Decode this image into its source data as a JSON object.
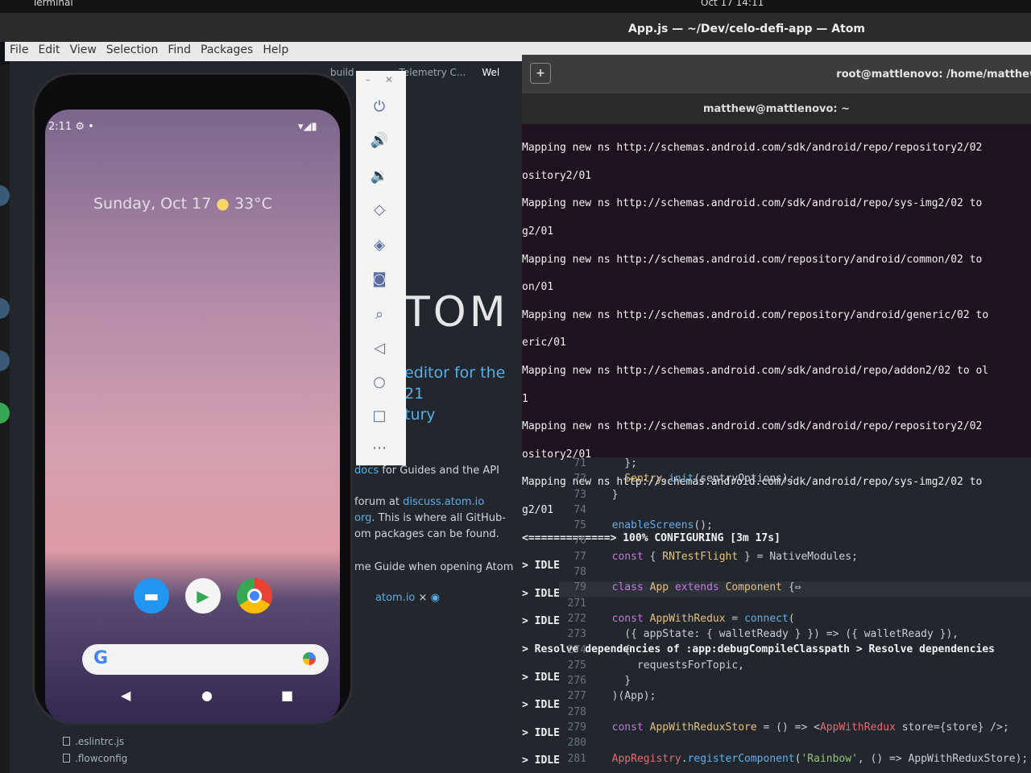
{
  "topbar": {
    "app": "Terminal",
    "clock": "Oct 17  14:11"
  },
  "atom": {
    "title": "App.js — ~/Dev/celo-defi-app — Atom",
    "menu": [
      "File",
      "Edit",
      "View",
      "Selection",
      "Find",
      "Packages",
      "Help"
    ],
    "tabs": [
      "build",
      "Telemetry C...",
      "Wel"
    ],
    "tree_bottom": [
      ".eslintrc.js",
      ".flowconfig"
    ]
  },
  "welcome": {
    "logo": "TOM",
    "title_line1": "editor for the 21",
    "title_line2": "tury",
    "docs_link": "docs",
    "docs_text": " for Guides and the API",
    "forum_text": "forum at ",
    "forum_link": "discuss.atom.io",
    "org_link": "org",
    "org_text": ". This is where all GitHub-",
    "packages_text": "om packages can be found.",
    "guide_text": "me Guide when opening Atom",
    "footer_link": "atom.io",
    "footer_sep": "×"
  },
  "phone": {
    "time": "2:11",
    "date": "Sunday, Oct 17",
    "weather": "33°C",
    "nav_back": "◀",
    "nav_home": "●",
    "nav_recents": "■"
  },
  "terminal": {
    "window_title": "root@mattlenovo: /home/matthew",
    "tab_title": "matthew@mattlenovo: ~",
    "lines": [
      "Mapping new ns http://schemas.android.com/sdk/android/repo/repository2/02",
      "ository2/01",
      "Mapping new ns http://schemas.android.com/sdk/android/repo/sys-img2/02 to",
      "g2/01",
      "Mapping new ns http://schemas.android.com/repository/android/common/02 to",
      "on/01",
      "Mapping new ns http://schemas.android.com/repository/android/generic/02 to",
      "eric/01",
      "Mapping new ns http://schemas.android.com/sdk/android/repo/addon2/02 to ol",
      "1",
      "Mapping new ns http://schemas.android.com/sdk/android/repo/repository2/02",
      "ository2/01",
      "Mapping new ns http://schemas.android.com/sdk/android/repo/sys-img2/02 to",
      "g2/01"
    ],
    "progress": "<=============> 100% CONFIGURING [3m 17s]",
    "idle_1": "> IDLE",
    "idle_2": "> IDLE",
    "idle_3": "> IDLE",
    "resolve": "> Resolve dependencies of :app:debugCompileClasspath > Resolve dependencies",
    "idle_4": "> IDLE",
    "idle_5": "> IDLE",
    "idle_6": "> IDLE",
    "idle_7": "> IDLE"
  },
  "code": {
    "l71": {
      "n": "71",
      "t": "    };"
    },
    "l72": {
      "n": "72",
      "a": "    ",
      "b": "Sentry",
      "c": ".",
      "d": "init",
      "e": "(sentryOptions);"
    },
    "l73": {
      "n": "73",
      "t": "  }"
    },
    "l74": {
      "n": "74",
      "t": ""
    },
    "l75": {
      "n": "75",
      "a": "  ",
      "b": "enableScreens",
      "c": "();"
    },
    "l76": {
      "n": "76",
      "t": ""
    },
    "l77": {
      "n": "77",
      "a": "  ",
      "b": "const",
      "c": " { ",
      "d": "RNTestFlight",
      "e": " } = NativeModules;"
    },
    "l78": {
      "n": "78",
      "t": ""
    },
    "l79": {
      "n": "79",
      "a": "  ",
      "b": "class",
      "c": " ",
      "d": "App",
      "e": " ",
      "f": "extends",
      "g": " ",
      "h": "Component",
      "i": " {⇔"
    },
    "l271": {
      "n": "271",
      "t": ""
    },
    "l272": {
      "n": "272",
      "a": "  ",
      "b": "const",
      "c": " ",
      "d": "AppWithRedux",
      "e": " = ",
      "f": "connect",
      "g": "("
    },
    "l273": {
      "n": "273",
      "t": "    ({ appState: { walletReady } }) => ({ walletReady }),"
    },
    "l274": {
      "n": "274",
      "t": "    {"
    },
    "l275": {
      "n": "275",
      "t": "      requestsForTopic,"
    },
    "l276": {
      "n": "276",
      "t": "    }"
    },
    "l277": {
      "n": "277",
      "t": "  )(App);"
    },
    "l278": {
      "n": "278",
      "t": ""
    },
    "l279": {
      "n": "279",
      "a": "  ",
      "b": "const",
      "c": " ",
      "d": "AppWithReduxStore",
      "e": " = () => <",
      "f": "AppWithRedux",
      "g": " store={store} />;"
    },
    "l280": {
      "n": "280",
      "t": ""
    },
    "l281": {
      "n": "281",
      "a": "  ",
      "b": "AppRegistry",
      "c": ".",
      "d": "registerComponent",
      "e": "(",
      "f": "'Rainbow'",
      "g": ", () => AppWithReduxStore);"
    }
  },
  "colors": {
    "accent": "#58aee8",
    "terminal_bg": "#2a1428",
    "editor_bg": "#22272e"
  }
}
